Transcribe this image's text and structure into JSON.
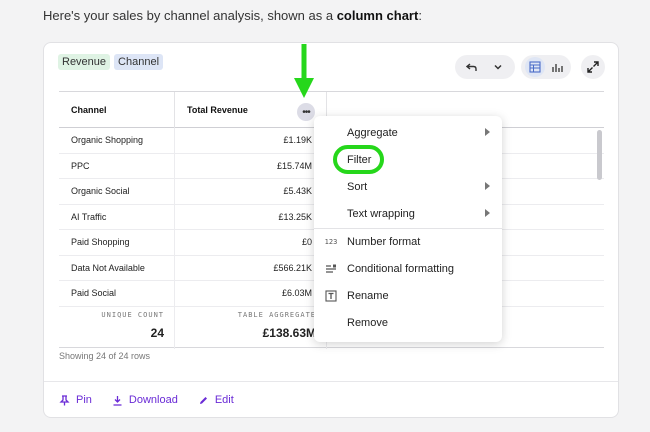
{
  "intro": {
    "text": "Here's your sales by channel analysis, shown as a ",
    "bold": "column chart",
    "end": ":"
  },
  "tags": [
    "Revenue",
    "Channel"
  ],
  "table": {
    "columns": [
      "Channel",
      "Total Revenue"
    ],
    "rows": [
      [
        "Organic Shopping",
        "£1.19K"
      ],
      [
        "PPC",
        "£15.74M"
      ],
      [
        "Organic Social",
        "£5.43K"
      ],
      [
        "AI Traffic",
        "£13.25K"
      ],
      [
        "Paid Shopping",
        "£0"
      ],
      [
        "Data Not Available",
        "£566.21K"
      ],
      [
        "Paid Social",
        "£6.03M"
      ]
    ],
    "summary": [
      {
        "label": "UNIQUE COUNT",
        "value": "24"
      },
      {
        "label": "TABLE AGGREGATE",
        "value": "£138.63M"
      }
    ],
    "showing": "Showing 24 of 24 rows"
  },
  "menu": {
    "items": [
      {
        "label": "Aggregate",
        "submenu": true,
        "icon": ""
      },
      {
        "label": "Filter",
        "submenu": false,
        "icon": ""
      },
      {
        "label": "Sort",
        "submenu": true,
        "icon": ""
      },
      {
        "label": "Text wrapping",
        "submenu": true,
        "icon": ""
      },
      {
        "label": "Number format",
        "submenu": false,
        "icon": "123"
      },
      {
        "label": "Conditional formatting",
        "submenu": false,
        "icon": "conditional-format-icon"
      },
      {
        "label": "Rename",
        "submenu": false,
        "icon": "rename-icon"
      },
      {
        "label": "Remove",
        "submenu": false,
        "icon": ""
      }
    ]
  },
  "actions": {
    "pin": "Pin",
    "download": "Download",
    "edit": "Edit"
  },
  "colors": {
    "accent": "#6a2bd6",
    "highlight": "#26d71b"
  }
}
